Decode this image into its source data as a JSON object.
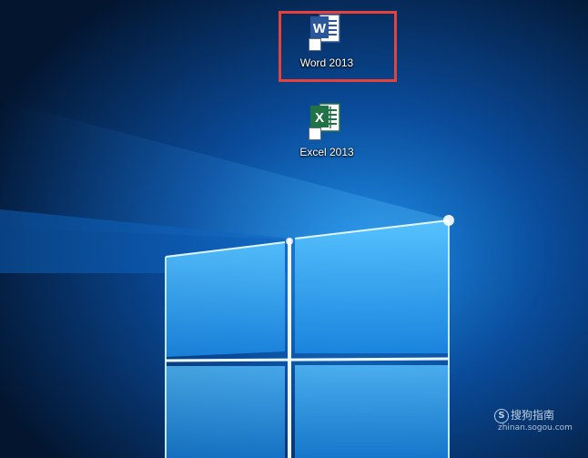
{
  "desktop": {
    "icons": [
      {
        "label": "Word 2013",
        "app_letter": "W",
        "color": "#2b579a",
        "icon": "word-icon"
      },
      {
        "label": "Excel 2013",
        "app_letter": "X",
        "color": "#217346",
        "icon": "excel-icon"
      }
    ],
    "highlight_color": "#e8403a"
  },
  "watermark": {
    "brand": "搜狗指南",
    "site": "zhinan.sogou.com"
  }
}
